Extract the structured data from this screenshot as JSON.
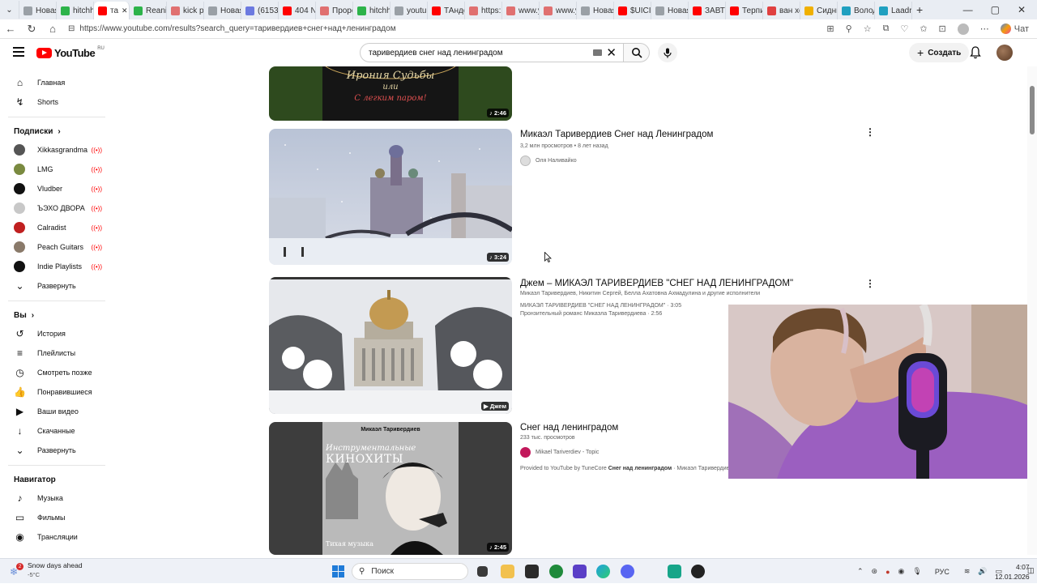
{
  "browser": {
    "tabs": [
      {
        "label": "Новая",
        "color": "#9aa0a6"
      },
      {
        "label": "hitchh",
        "color": "#2db34a"
      },
      {
        "label": "та",
        "color": "#ff0000"
      },
      {
        "label": "Reanir",
        "color": "#2db34a"
      },
      {
        "label": "kick p:",
        "color": "#e07070"
      },
      {
        "label": "Новая",
        "color": "#9aa0a6"
      },
      {
        "label": "(6153)",
        "color": "#6c7ae0"
      },
      {
        "label": "404 N",
        "color": "#ff0000"
      },
      {
        "label": "Проро",
        "color": "#e07070"
      },
      {
        "label": "hitchh",
        "color": "#2db34a"
      },
      {
        "label": "youtul",
        "color": "#9aa0a6"
      },
      {
        "label": "ТАнде",
        "color": "#ff0000"
      },
      {
        "label": "https:",
        "color": "#e07070"
      },
      {
        "label": "www.y",
        "color": "#e07070"
      },
      {
        "label": "www.y",
        "color": "#e07070"
      },
      {
        "label": "Новая",
        "color": "#9aa0a6"
      },
      {
        "label": "$UICI",
        "color": "#ff0000"
      },
      {
        "label": "Новая",
        "color": "#9aa0a6"
      },
      {
        "label": "ЗАВТР",
        "color": "#ff0000"
      },
      {
        "label": "Терпи",
        "color": "#ff0000"
      },
      {
        "label": "ван хе",
        "color": "#e04040"
      },
      {
        "label": "Сидни",
        "color": "#f0b000"
      },
      {
        "label": "Володі",
        "color": "#20a0c0"
      },
      {
        "label": "Laadr",
        "color": "#20a0c0"
      }
    ],
    "url": "https://www.youtube.com/results?search_query=таривердиев+снег+над+ленинградом",
    "copilot_label": "Чат"
  },
  "youtube": {
    "logo_text": "YouTube",
    "logo_region": "RU",
    "search_value": "таривердиев снег над ленинградом",
    "create_label": "Создать"
  },
  "sidebar": {
    "main": [
      {
        "label": "Главная",
        "icon": "home-icon",
        "glyph": "⌂"
      },
      {
        "label": "Shorts",
        "icon": "shorts-icon",
        "glyph": "↯"
      }
    ],
    "subs_title": "Подписки",
    "subs": [
      {
        "label": "Xikkasgrandma",
        "color": "#555"
      },
      {
        "label": "LMG",
        "color": "#7a8a40"
      },
      {
        "label": "Vludber",
        "color": "#111"
      },
      {
        "label": "ЪЭХО ДВОРА",
        "color": "#c8c8c8"
      },
      {
        "label": "Calradist",
        "color": "#c02020"
      },
      {
        "label": "Peach Guitars",
        "color": "#8a7a6a"
      },
      {
        "label": "Indie Playlists",
        "color": "#111"
      }
    ],
    "expand_label": "Развернуть",
    "you_title": "Вы",
    "you": [
      {
        "label": "История",
        "icon": "history-icon",
        "glyph": "↺"
      },
      {
        "label": "Плейлисты",
        "icon": "playlists-icon",
        "glyph": "≡"
      },
      {
        "label": "Смотреть позже",
        "icon": "watch-later-icon",
        "glyph": "◷"
      },
      {
        "label": "Понравившиеся",
        "icon": "like-icon",
        "glyph": "👍"
      },
      {
        "label": "Ваши видео",
        "icon": "your-videos-icon",
        "glyph": "▶"
      },
      {
        "label": "Скачанные",
        "icon": "download-icon",
        "glyph": "↓"
      }
    ],
    "expand2_label": "Развернуть",
    "nav_title": "Навигатор",
    "nav": [
      {
        "label": "Музыка",
        "icon": "music-icon",
        "glyph": "♪"
      },
      {
        "label": "Фильмы",
        "icon": "film-icon",
        "glyph": "▭"
      },
      {
        "label": "Трансляции",
        "icon": "live-icon",
        "glyph": "◉"
      }
    ]
  },
  "results": [
    {
      "duration": "♪ 2:46",
      "thumb_text1": "Ирония Судьбы",
      "thumb_text2": "или",
      "thumb_text3": "С легким паром!"
    },
    {
      "title": "Микаэл Таривердиев Снег над Ленинградом",
      "meta": "3,2 млн просмотров • 8 лет назад",
      "channel": "Оля Наливайко",
      "duration": "♪ 3:24"
    },
    {
      "title": "Джем – МИКАЭЛ ТАРИВЕРДИЕВ \"СНЕГ НАД ЛЕНИНГРАДОМ\"",
      "meta": "Микаэл Таривердиев, Никитин Сергей, Белла Ахатовна Ахмадулина и другие исполнители",
      "line1": "МИКАЭЛ ТАРИВЕРДИЕВ \"СНЕГ НАД ЛЕНИНГРАДОМ\" · 3:05",
      "line2": "Пронзительный романс Микаэла Таривердиева · 2:56",
      "duration": "▶ Джем"
    },
    {
      "title": "Снег над ленинградом",
      "meta": "233 тыс. просмотров",
      "channel": "Mikael Tariverdiev - Topic",
      "desc_prefix": "Provided to YouTube by TuneCore",
      "desc_bold": "Снег над ленинградом",
      "desc_suffix": "· Микаэл Таривердиев",
      "duration": "♪ 2:45",
      "cover_top": "Микаэл Таривердиев",
      "cover_mid1": "Инструментальные",
      "cover_mid2": "КИНОХИТЫ",
      "cover_bottom": "Тихая музыка"
    }
  ],
  "taskbar": {
    "weather_title": "Snow days ahead",
    "weather_temp": "-5°C",
    "weather_badge": "2",
    "search_label": "Поиск",
    "lang": "РУС",
    "time": "4:07",
    "date": "12.01.2026"
  }
}
